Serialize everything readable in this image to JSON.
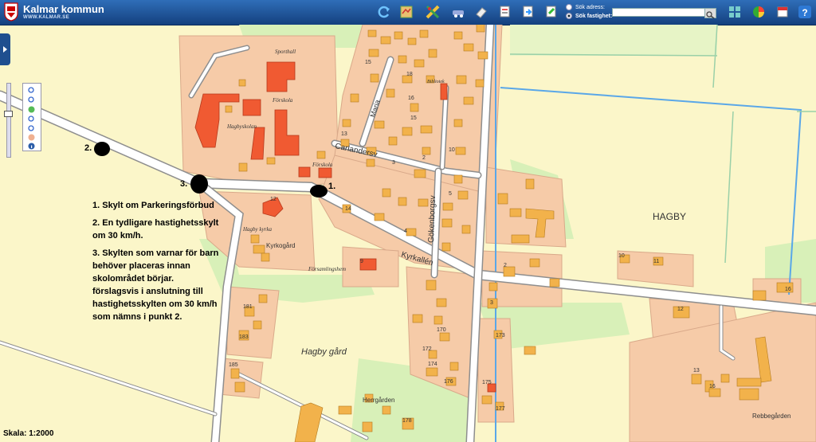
{
  "header": {
    "brand_name": "Kalmar kommun",
    "brand_url": "WWW.KALMAR.SE",
    "search_address_label": "Sök adress:",
    "search_property_label": "Sök fastighet:",
    "search_value": ""
  },
  "toolbar_icons": [
    "refresh-icon",
    "map-layers-icon",
    "measure-tools-icon",
    "vehicle-icon",
    "eraser-icon",
    "print-icon",
    "export-icon",
    "draw-icon",
    "grid-icon",
    "chart-icon",
    "bookmark-icon",
    "help-icon"
  ],
  "map": {
    "place_labels": {
      "hagby": "HAGBY",
      "hagby_gard": "Hagby gård",
      "herrgarden": "Herrgården",
      "rebbegarden": "Rebbegården",
      "kyrkogard": "Kyrkogård",
      "hagby_kyrka": "Hagby kyrka",
      "forsamlingshem": "Församlingshem",
      "sportball": "Sporthall",
      "forskola_1": "Förskola",
      "forskola_2": "Förskola",
      "hagbyskolan": "Hagbyskolan",
      "bibliotek": "Bibliotek"
    },
    "street_labels": {
      "carlandersv": "Carlandersv",
      "gokenborgsv": "Gökenborgsv",
      "kyrkallen": "Kyrkallén",
      "maria": "Maria"
    },
    "parcel_numbers": [
      "18",
      "16",
      "15",
      "13",
      "10",
      "2",
      "3",
      "4",
      "5",
      "9",
      "2",
      "3",
      "12",
      "14",
      "15",
      "170",
      "172",
      "174",
      "176",
      "173",
      "175",
      "177",
      "178",
      "181",
      "183",
      "185",
      "16",
      "10",
      "11",
      "12",
      "16",
      "13"
    ],
    "markers": [
      {
        "label": "1."
      },
      {
        "label": "2."
      },
      {
        "label": "3."
      }
    ]
  },
  "notes": [
    "1. Skylt om Parkeringsförbud",
    "2. En tydligare hastighetsskylt om 30 km/h.",
    "3. Skylten som varnar för barn behöver placeras innan skolområdet börjar. förslagsvis i anslutning till hastighetsskylten om 30 km/h som nämns i punkt 2."
  ],
  "scale_text": "Skala: 1:2000",
  "colors": {
    "background": "#fbf6c9",
    "residential": "#f6cba8",
    "building": "#f2b24b",
    "public_building": "#f05a32",
    "green": "#d8f0b8",
    "road": "#ffffff",
    "water_line": "#5aa7e8",
    "header": "#1a4a8a"
  }
}
